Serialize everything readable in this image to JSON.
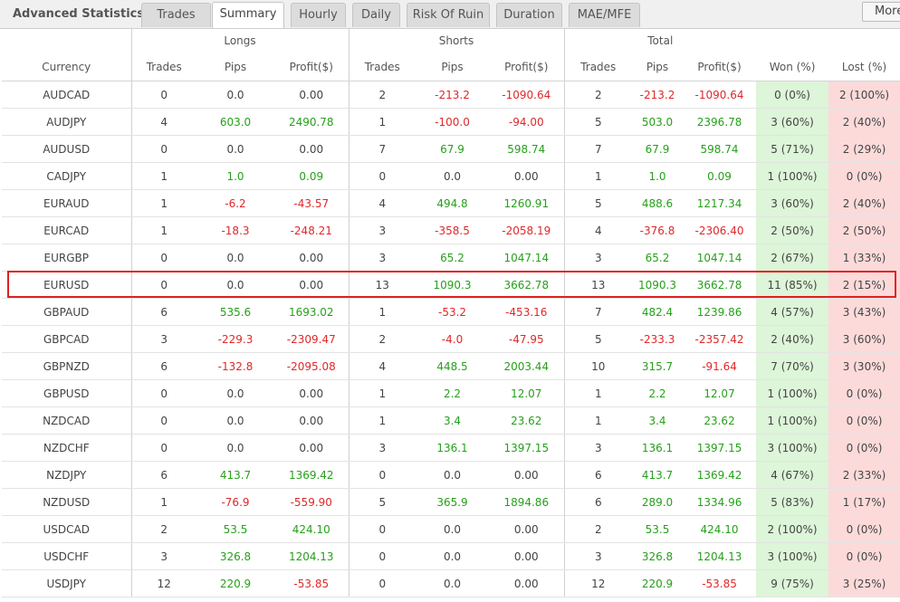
{
  "app_title": "Advanced Statistics",
  "tabs": [
    {
      "label": "Trades",
      "active": false
    },
    {
      "label": "Summary",
      "active": true
    },
    {
      "label": "Hourly",
      "active": false
    },
    {
      "label": "Daily",
      "active": false
    },
    {
      "label": "Risk Of Ruin",
      "active": false
    },
    {
      "label": "Duration",
      "active": false
    },
    {
      "label": "MAE/MFE",
      "active": false
    }
  ],
  "more_label": "More",
  "groups": {
    "longs": "Longs",
    "shorts": "Shorts",
    "total": "Total"
  },
  "columns": [
    "Currency",
    "Trades",
    "Pips",
    "Profit($)",
    "Trades",
    "Pips",
    "Profit($)",
    "Trades",
    "Pips",
    "Profit($)",
    "Won (%)",
    "Lost (%)"
  ],
  "highlighted_row": "EURUSD",
  "colors": {
    "positive": "#26a01a",
    "negative": "#e0282a",
    "won_bg": "#ddf5d8",
    "lost_bg": "#fcdada",
    "highlight": "#e31f1f"
  },
  "rows": [
    [
      "AUDCAD",
      "0",
      "0.0",
      "0.00",
      "2",
      "-213.2",
      "-1090.64",
      "2",
      "-213.2",
      "-1090.64",
      "0 (0%)",
      "2 (100%)"
    ],
    [
      "AUDJPY",
      "4",
      "603.0",
      "2490.78",
      "1",
      "-100.0",
      "-94.00",
      "5",
      "503.0",
      "2396.78",
      "3 (60%)",
      "2 (40%)"
    ],
    [
      "AUDUSD",
      "0",
      "0.0",
      "0.00",
      "7",
      "67.9",
      "598.74",
      "7",
      "67.9",
      "598.74",
      "5 (71%)",
      "2 (29%)"
    ],
    [
      "CADJPY",
      "1",
      "1.0",
      "0.09",
      "0",
      "0.0",
      "0.00",
      "1",
      "1.0",
      "0.09",
      "1 (100%)",
      "0 (0%)"
    ],
    [
      "EURAUD",
      "1",
      "-6.2",
      "-43.57",
      "4",
      "494.8",
      "1260.91",
      "5",
      "488.6",
      "1217.34",
      "3 (60%)",
      "2 (40%)"
    ],
    [
      "EURCAD",
      "1",
      "-18.3",
      "-248.21",
      "3",
      "-358.5",
      "-2058.19",
      "4",
      "-376.8",
      "-2306.40",
      "2 (50%)",
      "2 (50%)"
    ],
    [
      "EURGBP",
      "0",
      "0.0",
      "0.00",
      "3",
      "65.2",
      "1047.14",
      "3",
      "65.2",
      "1047.14",
      "2 (67%)",
      "1 (33%)"
    ],
    [
      "EURUSD",
      "0",
      "0.0",
      "0.00",
      "13",
      "1090.3",
      "3662.78",
      "13",
      "1090.3",
      "3662.78",
      "11 (85%)",
      "2 (15%)"
    ],
    [
      "GBPAUD",
      "6",
      "535.6",
      "1693.02",
      "1",
      "-53.2",
      "-453.16",
      "7",
      "482.4",
      "1239.86",
      "4 (57%)",
      "3 (43%)"
    ],
    [
      "GBPCAD",
      "3",
      "-229.3",
      "-2309.47",
      "2",
      "-4.0",
      "-47.95",
      "5",
      "-233.3",
      "-2357.42",
      "2 (40%)",
      "3 (60%)"
    ],
    [
      "GBPNZD",
      "6",
      "-132.8",
      "-2095.08",
      "4",
      "448.5",
      "2003.44",
      "10",
      "315.7",
      "-91.64",
      "7 (70%)",
      "3 (30%)"
    ],
    [
      "GBPUSD",
      "0",
      "0.0",
      "0.00",
      "1",
      "2.2",
      "12.07",
      "1",
      "2.2",
      "12.07",
      "1 (100%)",
      "0 (0%)"
    ],
    [
      "NZDCAD",
      "0",
      "0.0",
      "0.00",
      "1",
      "3.4",
      "23.62",
      "1",
      "3.4",
      "23.62",
      "1 (100%)",
      "0 (0%)"
    ],
    [
      "NZDCHF",
      "0",
      "0.0",
      "0.00",
      "3",
      "136.1",
      "1397.15",
      "3",
      "136.1",
      "1397.15",
      "3 (100%)",
      "0 (0%)"
    ],
    [
      "NZDJPY",
      "6",
      "413.7",
      "1369.42",
      "0",
      "0.0",
      "0.00",
      "6",
      "413.7",
      "1369.42",
      "4 (67%)",
      "2 (33%)"
    ],
    [
      "NZDUSD",
      "1",
      "-76.9",
      "-559.90",
      "5",
      "365.9",
      "1894.86",
      "6",
      "289.0",
      "1334.96",
      "5 (83%)",
      "1 (17%)"
    ],
    [
      "USDCAD",
      "2",
      "53.5",
      "424.10",
      "0",
      "0.0",
      "0.00",
      "2",
      "53.5",
      "424.10",
      "2 (100%)",
      "0 (0%)"
    ],
    [
      "USDCHF",
      "3",
      "326.8",
      "1204.13",
      "0",
      "0.0",
      "0.00",
      "3",
      "326.8",
      "1204.13",
      "3 (100%)",
      "0 (0%)"
    ],
    [
      "USDJPY",
      "12",
      "220.9",
      "-53.85",
      "0",
      "0.0",
      "0.00",
      "12",
      "220.9",
      "-53.85",
      "9 (75%)",
      "3 (25%)"
    ]
  ]
}
